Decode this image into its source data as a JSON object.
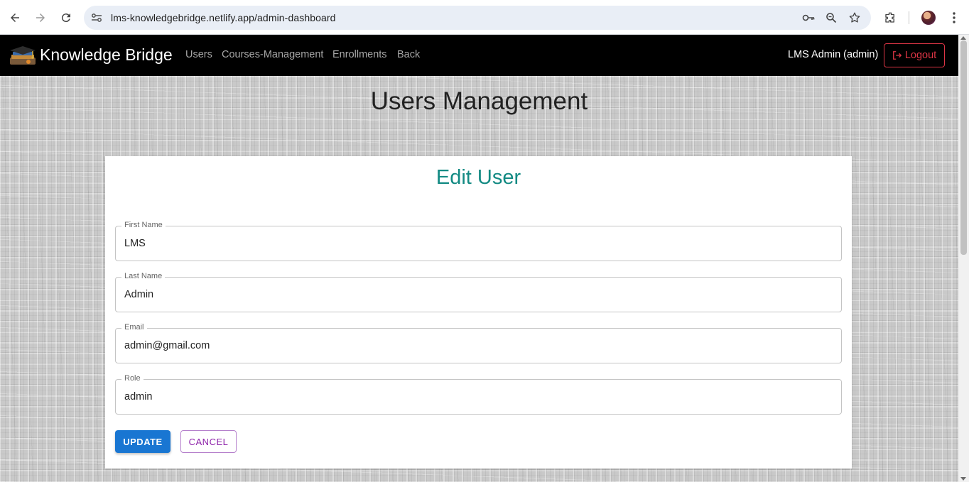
{
  "browser": {
    "url": "lms-knowledgebridge.netlify.app/admin-dashboard"
  },
  "navbar": {
    "brand": "Knowledge Bridge",
    "links": [
      "Users",
      "Courses-Management",
      "Enrollments",
      "Back"
    ],
    "user_label": "LMS Admin (admin)",
    "logout_label": "Logout"
  },
  "page": {
    "title": "Users Management"
  },
  "form": {
    "title": "Edit User",
    "fields": [
      {
        "label": "First Name",
        "value": "LMS"
      },
      {
        "label": "Last Name",
        "value": "Admin"
      },
      {
        "label": "Email",
        "value": "admin@gmail.com"
      },
      {
        "label": "Role",
        "value": "admin"
      }
    ],
    "update_label": "UPDATE",
    "cancel_label": "CANCEL"
  },
  "colors": {
    "accent_teal": "#138a83",
    "primary_blue": "#1976d2",
    "danger_red": "#dc3545",
    "secondary_purple": "#8e24aa"
  }
}
